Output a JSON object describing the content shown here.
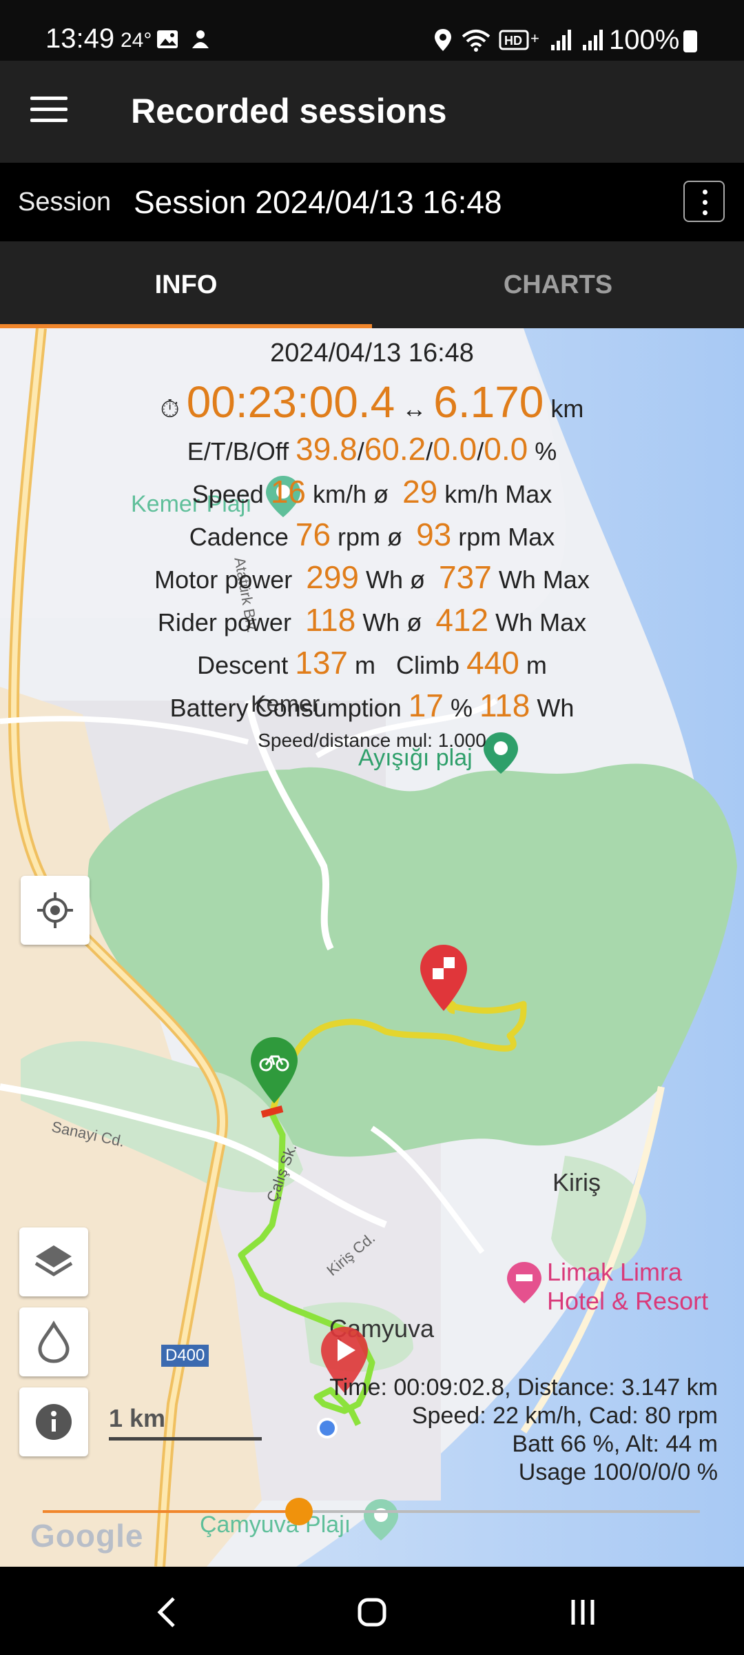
{
  "status_bar": {
    "time": "13:49",
    "temperature": "24°",
    "battery_percent": "100%",
    "icons": [
      "image-icon",
      "app-icon",
      "location-icon",
      "wifi-icon",
      "hd-icon",
      "signal-icon",
      "signal2-icon",
      "battery-icon"
    ]
  },
  "app_bar": {
    "title": "Recorded sessions"
  },
  "session_bar": {
    "label": "Session",
    "value": "Session 2024/04/13 16:48"
  },
  "tabs": [
    {
      "label": "INFO",
      "active": true
    },
    {
      "label": "CHARTS",
      "active": false
    }
  ],
  "stats": {
    "date": "2024/04/13 16:48",
    "duration": "00:23:00.4",
    "distance": "6.170",
    "distance_unit": "km",
    "etbo_label": "E/T/B/Off",
    "etbo_values": [
      "39.8",
      "60.2",
      "0.0",
      "0.0"
    ],
    "etbo_sep": "/",
    "etbo_unit": "%",
    "speed": {
      "label": "Speed",
      "avg": "16",
      "avg_unit": "km/h ø",
      "max": "29",
      "max_unit": "km/h Max"
    },
    "cadence": {
      "label": "Cadence",
      "avg": "76",
      "avg_unit": "rpm ø",
      "max": "93",
      "max_unit": "rpm Max"
    },
    "motor_power": {
      "label": "Motor power",
      "avg": "299",
      "avg_unit": "Wh ø",
      "max": "737",
      "max_unit": "Wh Max"
    },
    "rider_power": {
      "label": "Rider power",
      "avg": "118",
      "avg_unit": "Wh ø",
      "max": "412",
      "max_unit": "Wh Max"
    },
    "descent": {
      "label": "Descent",
      "value": "137",
      "unit": "m"
    },
    "climb": {
      "label": "Climb",
      "value": "440",
      "unit": "m"
    },
    "battery": {
      "label": "Battery Consumption",
      "percent": "17",
      "percent_unit": "%",
      "wh": "118",
      "wh_unit": "Wh"
    },
    "caption": "Speed/distance mul: 1.000"
  },
  "map": {
    "labels": {
      "kemer": "Kemer",
      "kemer_plaji": "Kemer Plajı",
      "atatürk_blv": "Atatürk Blv.",
      "aysigi_plaj": "Ayışığı plaj",
      "sanayi_cd": "Sanayi Cd.",
      "calis_sk": "Çalış Sk.",
      "kiris": "Kiriş",
      "kiris_cd": "Kiriş Cd.",
      "limak": "Limak Limra",
      "limak2": "Hotel & Resort",
      "camyuva": "Çamyuva",
      "camyuva_plaji": "Çamyuva Plajı",
      "d400": "D400"
    },
    "point_info": [
      "Time: 00:09:02.8, Distance: 3.147 km",
      "Speed: 22 km/h, Cad: 80 rpm",
      "Batt 66 %, Alt: 44 m",
      "Usage 100/0/0/0 %"
    ],
    "scale": "1 km",
    "slider_fraction": 0.39,
    "google": "Google",
    "accent_color": "#f0862c"
  },
  "nav_bar": {
    "buttons": [
      "back",
      "home",
      "recents"
    ]
  }
}
